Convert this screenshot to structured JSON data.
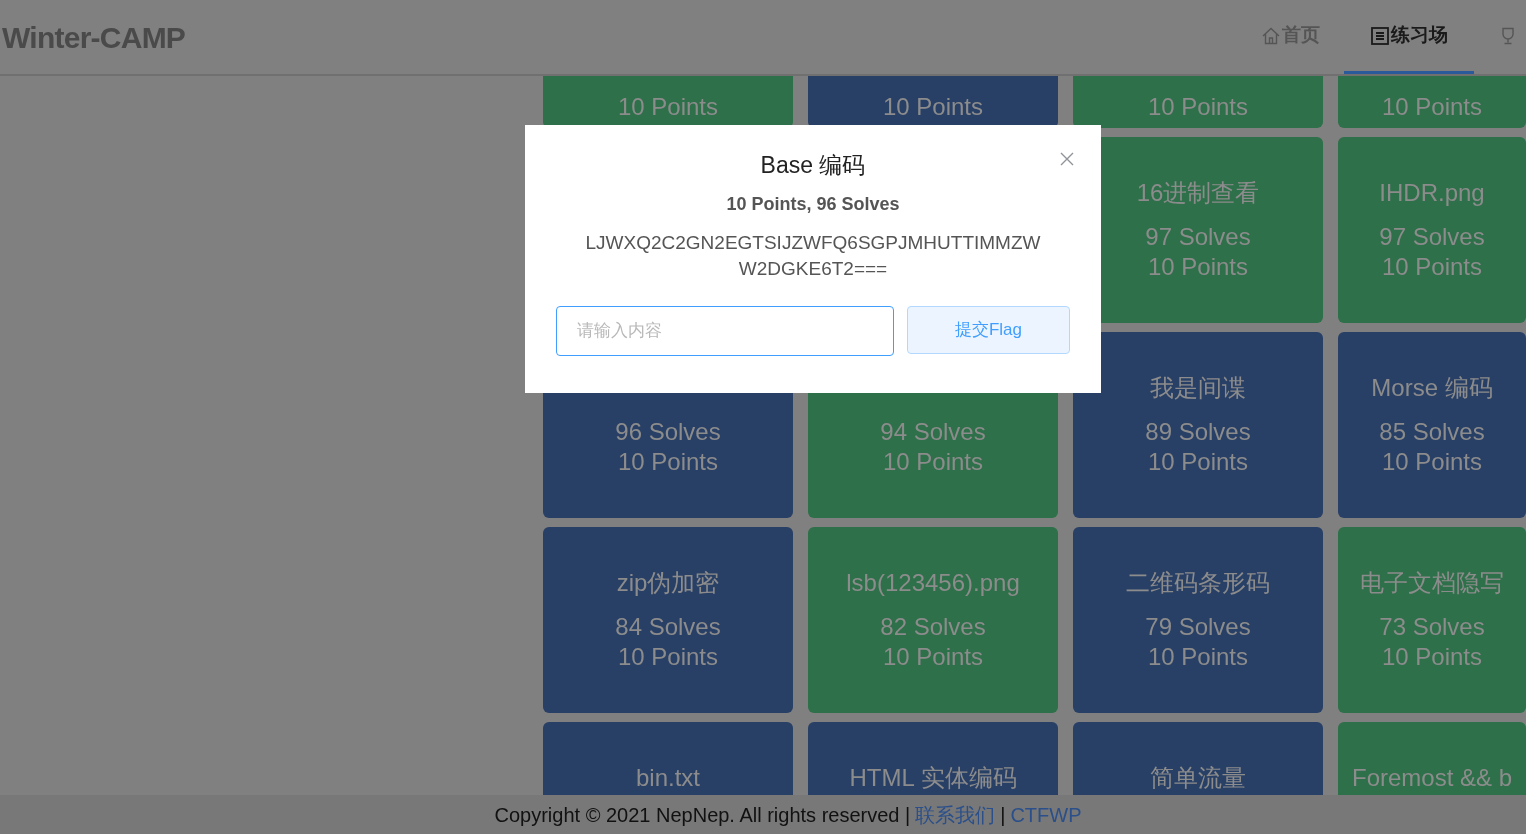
{
  "logo": "Winter-CAMP",
  "nav": [
    {
      "kind": "home",
      "label": "首页",
      "selected": false
    },
    {
      "kind": "list",
      "label": "练习场",
      "selected": true
    },
    {
      "kind": "trophy",
      "selected": false
    }
  ],
  "challenge_rows": [
    {
      "kind": "partial",
      "cards": [
        {
          "color": "#2d7049",
          "points": "10 Points"
        },
        {
          "color": "#283f66",
          "points": "10 Points"
        },
        {
          "color": "#2d7049",
          "points": "10 Points"
        },
        {
          "color": "#2d7049",
          "points": "10 Points"
        }
      ]
    },
    {
      "kind": "full",
      "cards": [
        {
          "color": "#2d7049",
          "title": "16进制查看",
          "solves": "97 Solves",
          "points": "10 Points"
        },
        {
          "color": "#2d7049",
          "title": "IHDR.png",
          "solves": "97 Solves",
          "points": "10 Points"
        }
      ]
    },
    {
      "kind": "full",
      "cards": [
        {
          "color": "#283f66",
          "solves": "96 Solves",
          "points": "10 Points"
        },
        {
          "color": "#2d7049",
          "solves": "94 Solves",
          "points": "10 Points"
        },
        {
          "color": "#283f66",
          "title": "我是间谍",
          "solves": "89 Solves",
          "points": "10 Points"
        },
        {
          "color": "#283f66",
          "title": "Morse 编码",
          "solves": "85 Solves",
          "points": "10 Points"
        }
      ]
    },
    {
      "kind": "full",
      "cards": [
        {
          "color": "#283f66",
          "title": "zip伪加密",
          "solves": "84 Solves",
          "points": "10 Points"
        },
        {
          "color": "#2d7049",
          "title": "lsb(123456).png",
          "solves": "82 Solves",
          "points": "10 Points"
        },
        {
          "color": "#283f66",
          "title": "二维码条形码",
          "solves": "79 Solves",
          "points": "10 Points"
        },
        {
          "color": "#2d7049",
          "title": "电子文档隐写",
          "solves": "73 Solves",
          "points": "10 Points"
        }
      ]
    },
    {
      "kind": "bottom",
      "cards": [
        {
          "color": "#283f66",
          "title": "bin.txt"
        },
        {
          "color": "#283f66",
          "title": "HTML 实体编码"
        },
        {
          "color": "#283f66",
          "title": "简单流量"
        },
        {
          "color": "#2d7049",
          "title": "Foremost && b"
        }
      ]
    }
  ],
  "footer": {
    "text": "Copyright © 2021 NepNep. All rights reserved |",
    "links": [
      "联系我们",
      "CTFWP"
    ],
    "separator": "|"
  },
  "modal": {
    "title": "Base 编码",
    "subtitle": "10 Points, 96 Solves",
    "description": "LJWXQ2C2GN2EGTSIJZWFQ6SGPJMHUTTIMMZWW2DGKE6T2===",
    "input": {
      "placeholder": "请输入内容"
    },
    "submit": "提交Flag"
  }
}
